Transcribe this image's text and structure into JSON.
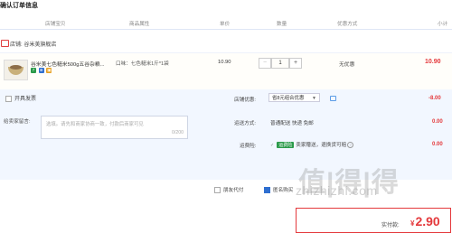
{
  "page": {
    "title": "确认订单信息"
  },
  "table_headers": [
    "店铺宝贝",
    "商品属性",
    "单价",
    "数量",
    "优惠方式",
    "小计"
  ],
  "shop": {
    "label": "店铺: 谷米美旗舰店"
  },
  "item": {
    "name": "谷米美七色糙米500g五谷杂粮...",
    "badges": [
      "7",
      "⊕",
      "▣"
    ],
    "attribute": "口味：七色糙米1斤*1袋",
    "price": "10.90",
    "quantity": "1",
    "minus_label": "−",
    "plus_label": "+",
    "discount": "无优惠",
    "subtotal": "10.90"
  },
  "extras": {
    "invoice_label": "开具发票",
    "message_label": "给卖家留言:",
    "message_placeholder": "选填。请先和商家协商一致，付款后商家可见",
    "message_count": "0/200",
    "shop_discount_label": "店铺优惠:",
    "shop_discount_value": "省8元组合优惠",
    "shop_discount_amount": "-8.00",
    "shipping_label": "运送方式:",
    "shipping_value": "普通配送 快递 免邮",
    "shipping_amount": "0.00",
    "insurance_label": "运费险:",
    "insurance_pill": "运费险",
    "insurance_value": "卖家赠送，退换货可赔",
    "insurance_amount": "0.00"
  },
  "footer": {
    "options": [
      "朋友代付",
      "匿名购买"
    ],
    "pay_label": "实付款:",
    "pay_currency": "¥",
    "pay_amount": "2.90"
  },
  "watermark": {
    "text": "值|得|得",
    "url": "zhizhizhi.com"
  },
  "colors": {
    "accent": "#e4393c",
    "panel": "#f2f7ff",
    "primary": "#2f6fd0"
  }
}
